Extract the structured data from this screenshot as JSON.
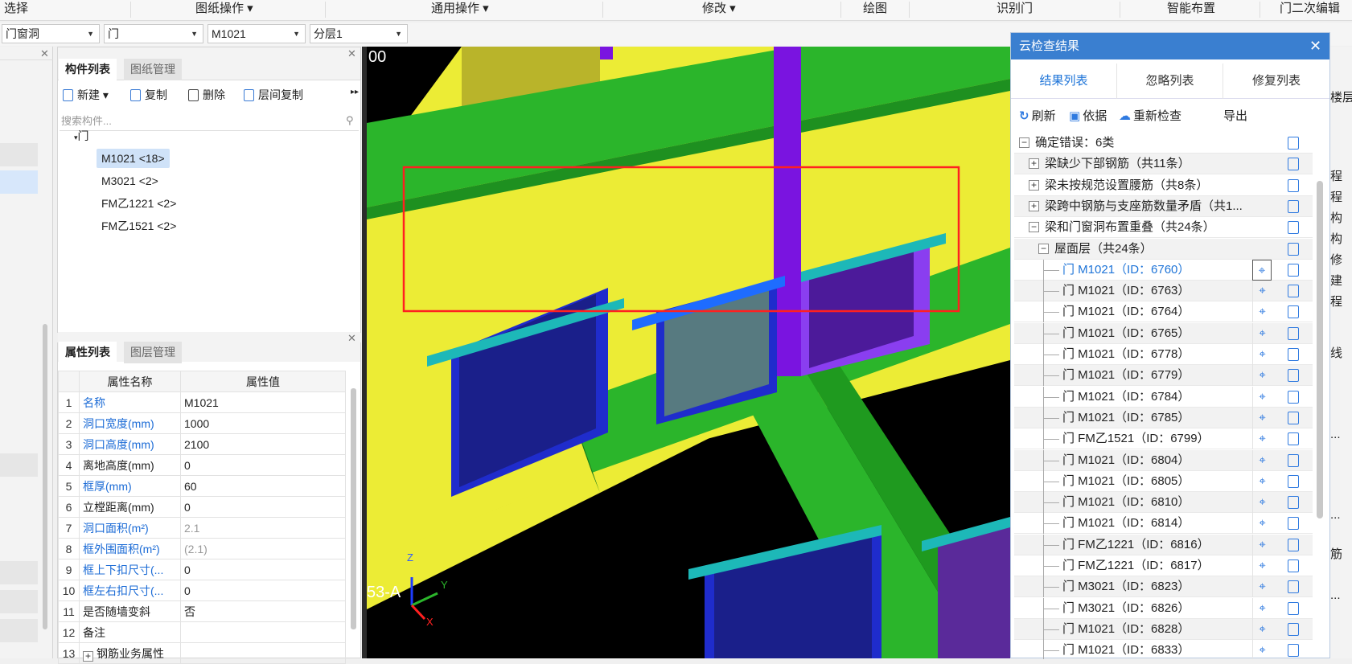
{
  "topbar": {
    "items": [
      "选择",
      "图纸操作 ▾",
      "通用操作 ▾",
      "修改 ▾",
      "绘图",
      "识别门",
      "智能布置",
      "门二次编辑"
    ]
  },
  "selectors": [
    "门窗洞",
    "门",
    "M1021",
    "分层1"
  ],
  "component_panel": {
    "tabs": [
      "构件列表",
      "图纸管理"
    ],
    "tools": [
      "新建 ▾",
      "复制",
      "删除",
      "层间复制"
    ],
    "search_placeholder": "搜索构件...",
    "root": "门",
    "items": [
      "M1021 <18>",
      "M3021 <2>",
      "FM乙1221 <2>",
      "FM乙1521 <2>"
    ]
  },
  "property_panel": {
    "tabs": [
      "属性列表",
      "图层管理"
    ],
    "headers": [
      "属性名称",
      "属性值"
    ],
    "rows": [
      {
        "n": "1",
        "name": "名称",
        "value": "M1021"
      },
      {
        "n": "2",
        "name": "洞口宽度(mm)",
        "value": "1000"
      },
      {
        "n": "3",
        "name": "洞口高度(mm)",
        "value": "2100"
      },
      {
        "n": "4",
        "name": "离地高度(mm)",
        "value": "0"
      },
      {
        "n": "5",
        "name": "框厚(mm)",
        "value": "60"
      },
      {
        "n": "6",
        "name": "立樘距离(mm)",
        "value": "0"
      },
      {
        "n": "7",
        "name": "洞口面积(m²)",
        "value": "2.1"
      },
      {
        "n": "8",
        "name": "框外围面积(m²)",
        "value": "(2.1)"
      },
      {
        "n": "9",
        "name": "框上下扣尺寸(...",
        "value": "0"
      },
      {
        "n": "10",
        "name": "框左右扣尺寸(...",
        "value": "0"
      },
      {
        "n": "11",
        "name": "是否随墙变斜",
        "value": "否"
      },
      {
        "n": "12",
        "name": "备注",
        "value": ""
      },
      {
        "n": "13",
        "name": "钢筋业务属性",
        "value": ""
      }
    ]
  },
  "viewport": {
    "axis_label": "53-A",
    "axis_x": "X",
    "axis_y": "Y",
    "axis_z": "Z",
    "corner_text": "00"
  },
  "cloud_check": {
    "title": "云检查结果",
    "tabs": [
      "结果列表",
      "忽略列表",
      "修复列表"
    ],
    "tools": [
      "刷新",
      "依据",
      "重新检查",
      "导出"
    ],
    "tree": [
      {
        "label": "确定错误：6类",
        "level": 0,
        "box": "−"
      },
      {
        "label": "梁缺少下部钢筋（共11条）",
        "level": 1,
        "box": "+"
      },
      {
        "label": "梁未按规范设置腰筋（共8条）",
        "level": 1,
        "box": "+"
      },
      {
        "label": "梁跨中钢筋与支座筋数量矛盾（共1...",
        "level": 1,
        "box": "+"
      },
      {
        "label": "梁和门窗洞布置重叠（共24条）",
        "level": 1,
        "box": "−"
      },
      {
        "label": "屋面层（共24条）",
        "level": 2,
        "box": "−"
      }
    ],
    "results": [
      "门 M1021（ID：6760）",
      "门 M1021（ID：6763）",
      "门 M1021（ID：6764）",
      "门 M1021（ID：6765）",
      "门 M1021（ID：6778）",
      "门 M1021（ID：6779）",
      "门 M1021（ID：6784）",
      "门 M1021（ID：6785）",
      "门 FM乙1521（ID：6799）",
      "门 M1021（ID：6804）",
      "门 M1021（ID：6805）",
      "门 M1021（ID：6810）",
      "门 M1021（ID：6814）",
      "门 FM乙1221（ID：6816）",
      "门 FM乙1221（ID：6817）",
      "门 M3021（ID：6823）",
      "门 M3021（ID：6826）",
      "门 M1021（ID：6828）",
      "门 M1021（ID：6833）"
    ]
  },
  "right_strip": [
    "楼层显",
    "程",
    "程",
    "构",
    "构",
    "修",
    "建",
    "程",
    "线",
    "...",
    "...",
    "筋",
    "..."
  ],
  "colors": {
    "accent": "#3a7fd0",
    "link": "#1b6bd6",
    "wall": "#ecec35",
    "beam": "#2bb52b",
    "column": "#7a14e0",
    "highlight": "#ff2020"
  }
}
